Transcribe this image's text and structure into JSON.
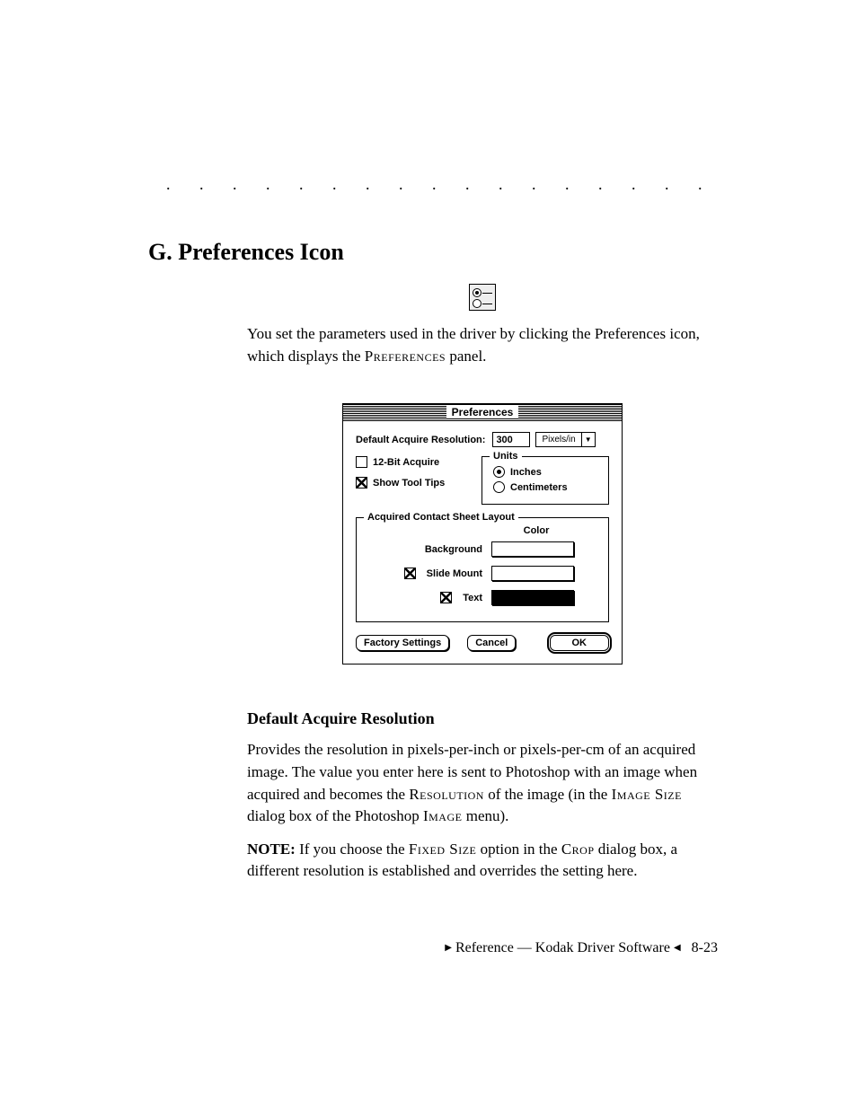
{
  "dots": ". . . . . . . . . . . . . . . . . . . . . . . . . . . . . . . . .",
  "heading": "G. Preferences Icon",
  "intro_part1": "You set the parameters used in the driver by clicking the Preferences icon, which displays the ",
  "intro_smallcaps": "Preferences",
  "intro_part2": " panel.",
  "dialog": {
    "title": "Preferences",
    "resolution_label": "Default Acquire Resolution:",
    "resolution_value": "300",
    "resolution_units": "Pixels/in",
    "checkbox_12bit": "12-Bit Acquire",
    "checkbox_12bit_checked": false,
    "checkbox_tooltips": "Show Tool Tips",
    "checkbox_tooltips_checked": true,
    "units_group": "Units",
    "units_inches": "Inches",
    "units_cm": "Centimeters",
    "units_selected": "Inches",
    "contact_group": "Acquired Contact Sheet Layout",
    "color_header": "Color",
    "background_label": "Background",
    "slidemount_label": "Slide Mount",
    "slidemount_checked": true,
    "text_label": "Text",
    "text_checked": true,
    "background_color": "#ffffff",
    "slidemount_color": "#ffffff",
    "text_color": "#000000",
    "btn_factory": "Factory Settings",
    "btn_cancel": "Cancel",
    "btn_ok": "OK"
  },
  "subheading": "Default Acquire Resolution",
  "para1_a": "Provides the resolution in pixels-per-inch or pixels-per-cm of an acquired image. The value you enter here is sent to Photoshop with an image when acquired and becomes the ",
  "para1_sc1": "Resolution",
  "para1_b": " of the image (in the ",
  "para1_sc2": "Image Size",
  "para1_c": " dialog box of the Photoshop ",
  "para1_sc3": "Image",
  "para1_d": " menu).",
  "note_label": "NOTE:",
  "note_a": " If you choose the ",
  "note_sc1": "Fixed Size",
  "note_b": " option in the ",
  "note_sc2": "Crop",
  "note_c": " dialog box, a different resolution is established and overrides the setting here.",
  "footer_text": "Reference — Kodak Driver Software",
  "page_number": "8-23"
}
